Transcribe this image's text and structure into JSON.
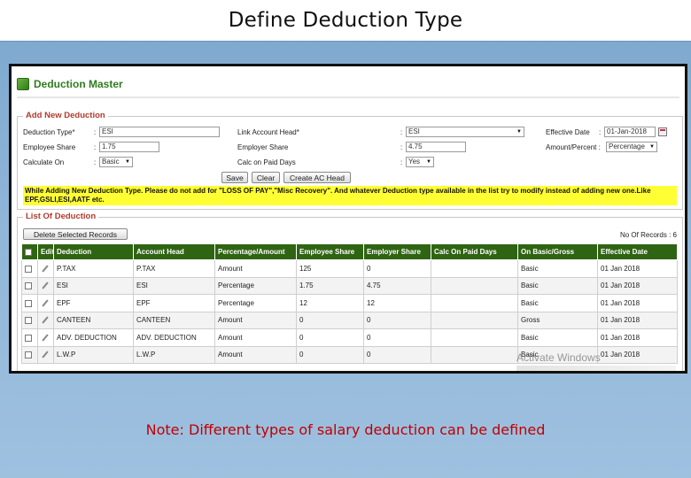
{
  "slide_title": "Define Deduction Type",
  "note": "Note: Different types of salary deduction can be defined",
  "header": {
    "title": "Deduction Master",
    "icon": "deduction-master-icon"
  },
  "add_section": {
    "legend": "Add New Deduction",
    "deduction_type_label": "Deduction Type*",
    "deduction_type_value": "ESI",
    "link_account_label": "Link Account Head*",
    "link_account_value": "ESI",
    "effective_date_label": "Effective Date",
    "effective_date_value": "01-Jan-2018",
    "employee_share_label": "Employee Share",
    "employee_share_value": "1.75",
    "employer_share_label": "Employer Share",
    "employer_share_value": "4.75",
    "amount_percent_label": "Amount/Percent :",
    "amount_percent_value": "Percentage",
    "calculate_on_label": "Calculate On",
    "calculate_on_value": "Basic",
    "calc_paid_days_label": "Calc on Paid Days",
    "calc_paid_days_value": "Yes",
    "colon": ":",
    "buttons": {
      "save": "Save",
      "clear": "Clear",
      "create_head": "Create AC Head"
    },
    "warning": "While Adding New Deduction Type. Please do not add for \"LOSS OF PAY\",\"Misc Recovery\". And whatever Deduction type available in the list try to modify instead of adding new one.Like EPF,GSLI,ESI,AATF etc."
  },
  "list_section": {
    "legend": "List Of Deduction",
    "delete_button": "Delete Selected Records",
    "records_label": "No Of Records : 6",
    "columns": [
      "",
      "Edit",
      "Deduction",
      "Account Head",
      "Percentage/Amount",
      "Employee Share",
      "Employer Share",
      "Calc On Paid Days",
      "On Basic/Gross",
      "Effective Date"
    ],
    "rows": [
      [
        "P.TAX",
        "P.TAX",
        "Amount",
        "125",
        "0",
        "",
        "Basic",
        "01 Jan 2018"
      ],
      [
        "ESI",
        "ESI",
        "Percentage",
        "1.75",
        "4.75",
        "",
        "Basic",
        "01 Jan 2018"
      ],
      [
        "EPF",
        "EPF",
        "Percentage",
        "12",
        "12",
        "",
        "Basic",
        "01 Jan 2018"
      ],
      [
        "CANTEEN",
        "CANTEEN",
        "Amount",
        "0",
        "0",
        "",
        "Gross",
        "01 Jan 2018"
      ],
      [
        "ADV. DEDUCTION",
        "ADV. DEDUCTION",
        "Amount",
        "0",
        "0",
        "",
        "Basic",
        "01 Jan 2018"
      ],
      [
        "L.W.P",
        "L.W.P",
        "Amount",
        "0",
        "0",
        "",
        "Basic",
        "01 Jan 2018"
      ]
    ]
  },
  "watermark": "Activate Windows",
  "colors": {
    "header_green": "#2f6413",
    "title_green": "#2e7d1e",
    "legend_red": "#b03a2e",
    "note_red": "#c00000",
    "warning_yellow": "#ffff33"
  }
}
